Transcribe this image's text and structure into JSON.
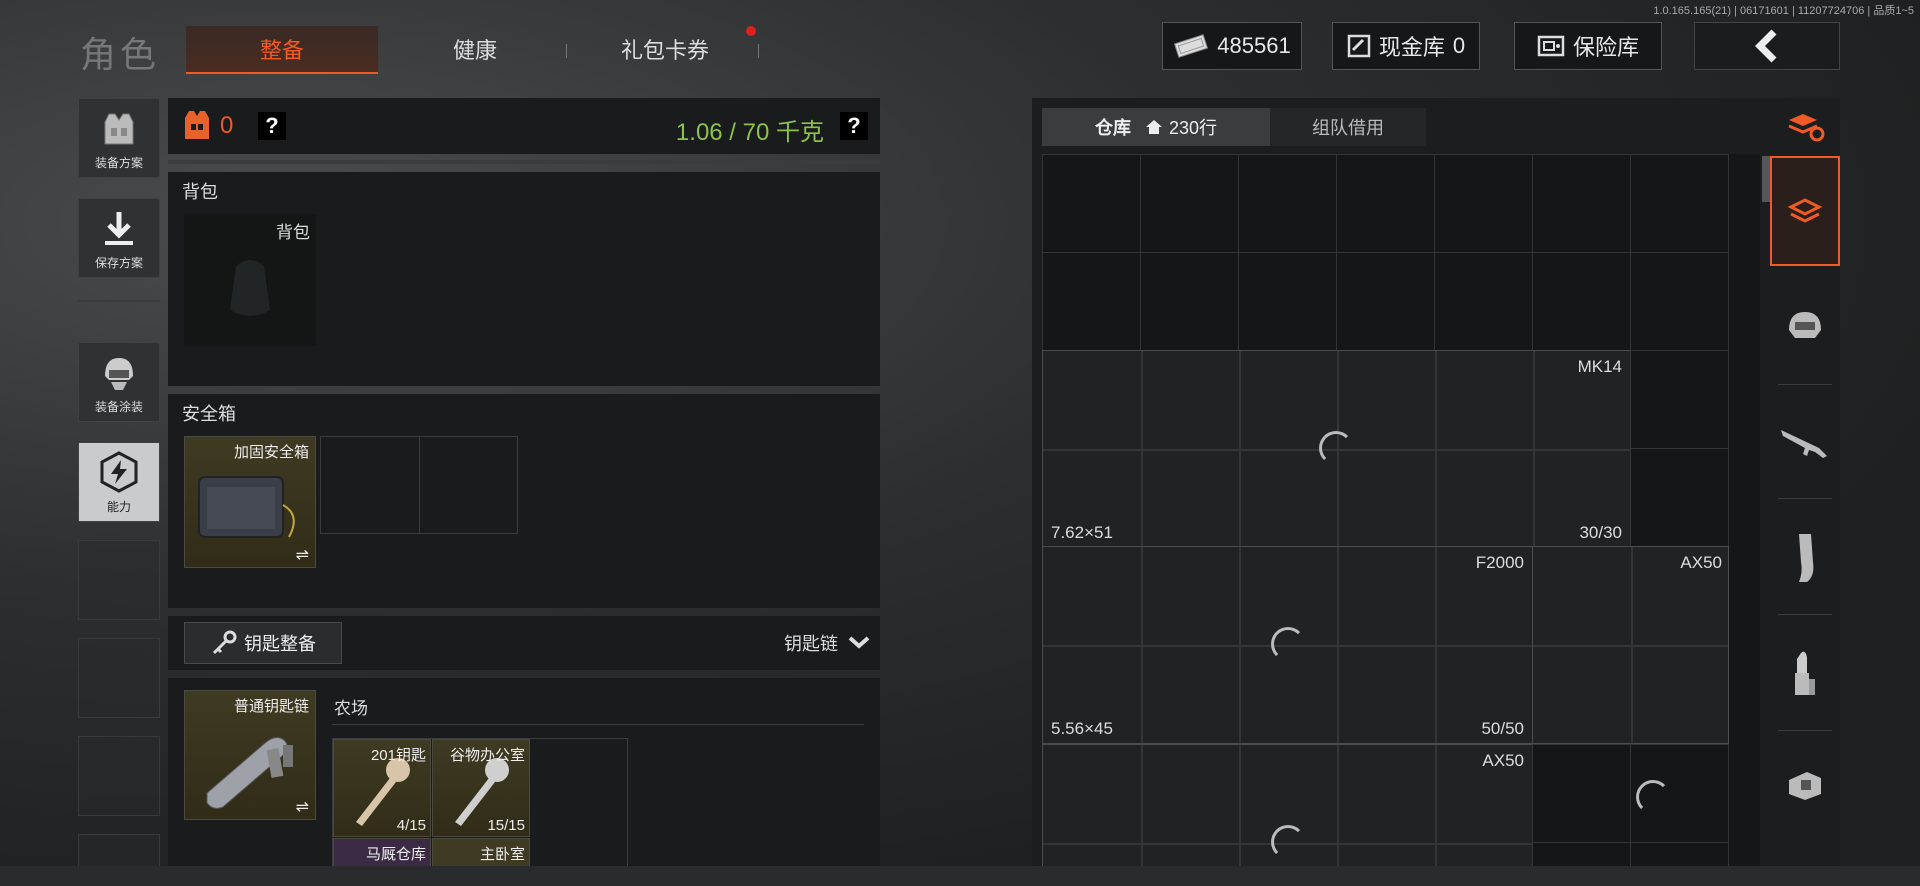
{
  "version_info": "1.0.165.165(21) | 06171601 | 11207724706 | 品质1~5",
  "nav": {
    "title": "角色",
    "tabs": [
      {
        "label": "整备",
        "active": true
      },
      {
        "label": "健康",
        "active": false
      },
      {
        "label": "礼包卡券",
        "active": false,
        "badge": true
      }
    ]
  },
  "header": {
    "money_value": "485561",
    "cash_vault_label": "现金库",
    "cash_vault_value": "0",
    "safe_label": "保险库"
  },
  "sidebar": {
    "items": [
      {
        "label": "装备方案",
        "icon": "vest-icon"
      },
      {
        "label": "保存方案",
        "icon": "download-icon"
      },
      {
        "label": "装备涂装",
        "icon": "helmet-icon"
      },
      {
        "label": "能力",
        "icon": "ability-icon"
      }
    ]
  },
  "loadout": {
    "armor_count": "0",
    "help_mark": "?",
    "weight": "1.06 / 70 千克",
    "backpack_title": "背包",
    "backpack_slot_label": "背包",
    "safebox_title": "安全箱",
    "safebox_item": "加固安全箱",
    "swap_symbol": "⇌",
    "key_button": "钥匙整备",
    "keychain_dropdown": "钥匙链",
    "keychain_item": "普通钥匙链",
    "key_area": "农场",
    "keys": [
      {
        "name": "201钥匙",
        "count": "4/15"
      },
      {
        "name": "谷物办公室",
        "count": "15/15"
      }
    ],
    "keys_row2": [
      "马厩仓库",
      "主卧室"
    ]
  },
  "warehouse": {
    "tabs": [
      {
        "label": "仓库",
        "rows": "230行",
        "active": true
      },
      {
        "label": "组队借用",
        "active": false
      }
    ],
    "items": [
      {
        "name": "MK14",
        "caliber": "7.62×51",
        "ammo": "30/30"
      },
      {
        "name": "F2000",
        "caliber": "5.56×45",
        "ammo": "50/50"
      },
      {
        "name": "AX50",
        "caliber": "",
        "ammo": ""
      },
      {
        "name": "AX50",
        "caliber": "",
        "ammo": ""
      }
    ]
  },
  "right_tools": [
    "sort-icon",
    "all-items-icon",
    "helmet-filter-icon",
    "rifle-filter-icon",
    "magazine-filter-icon",
    "ammo-filter-icon",
    "scope-filter-icon"
  ],
  "colors": {
    "accent": "#f15a24",
    "weight_ok": "#8bc34a",
    "badge": "#e0201c"
  }
}
